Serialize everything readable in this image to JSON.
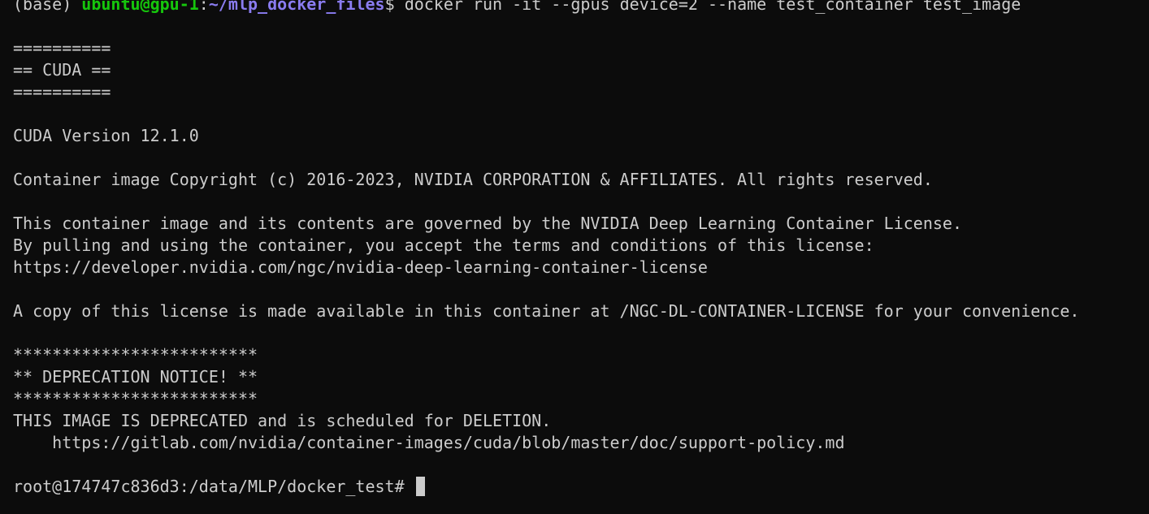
{
  "prompt": {
    "env": "(base) ",
    "user_host": "ubuntu@gpu-1",
    "colon": ":",
    "cwd": "~/mlp_docker_files",
    "symbol": "$ ",
    "command": "docker run -it --gpus device=2 --name test_container test_image"
  },
  "output": {
    "banner_top": "==========",
    "banner_title": "== CUDA ==",
    "banner_bottom": "==========",
    "cuda_version": "CUDA Version 12.1.0",
    "copyright": "Container image Copyright (c) 2016-2023, NVIDIA CORPORATION & AFFILIATES. All rights reserved.",
    "license_1": "This container image and its contents are governed by the NVIDIA Deep Learning Container License.",
    "license_2": "By pulling and using the container, you accept the terms and conditions of this license:",
    "license_url": "https://developer.nvidia.com/ngc/nvidia-deep-learning-container-license",
    "license_copy": "A copy of this license is made available in this container at /NGC-DL-CONTAINER-LICENSE for your convenience.",
    "stars_top": "*************************",
    "deprecation_title": "** DEPRECATION NOTICE! **",
    "stars_bottom": "*************************",
    "deprecation_text": "THIS IMAGE IS DEPRECATED and is scheduled for DELETION.",
    "deprecation_url": "    https://gitlab.com/nvidia/container-images/cuda/blob/master/doc/support-policy.md"
  },
  "container_prompt": "root@174747c836d3:/data/MLP/docker_test# ",
  "colors": {
    "background": "#0c0c0c",
    "text": "#cccccc",
    "user_host": "#16c60c",
    "path": "#8a7cf0"
  }
}
